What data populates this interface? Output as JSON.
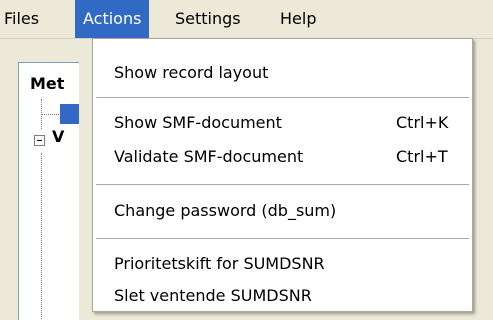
{
  "menubar": {
    "items": [
      {
        "label": "Files"
      },
      {
        "label": "Actions"
      },
      {
        "label": "Settings"
      },
      {
        "label": "Help"
      }
    ]
  },
  "background": {
    "panel_title_fragment": "Met",
    "tree_child_fragment": "V"
  },
  "dropdown": {
    "items": [
      {
        "label": "Show record layout",
        "shortcut": ""
      },
      {
        "label": "Show SMF-document",
        "shortcut": "Ctrl+K"
      },
      {
        "label": "Validate SMF-document",
        "shortcut": "Ctrl+T"
      },
      {
        "label": "Change password (db_sum)",
        "shortcut": ""
      },
      {
        "label": "Prioritetskift for SUMDSNR",
        "shortcut": ""
      },
      {
        "label": "Slet ventende SUMDSNR",
        "shortcut": ""
      }
    ]
  },
  "colors": {
    "menu_bg": "#ece9d8",
    "highlight": "#316ac5",
    "separator": "#aca899"
  }
}
